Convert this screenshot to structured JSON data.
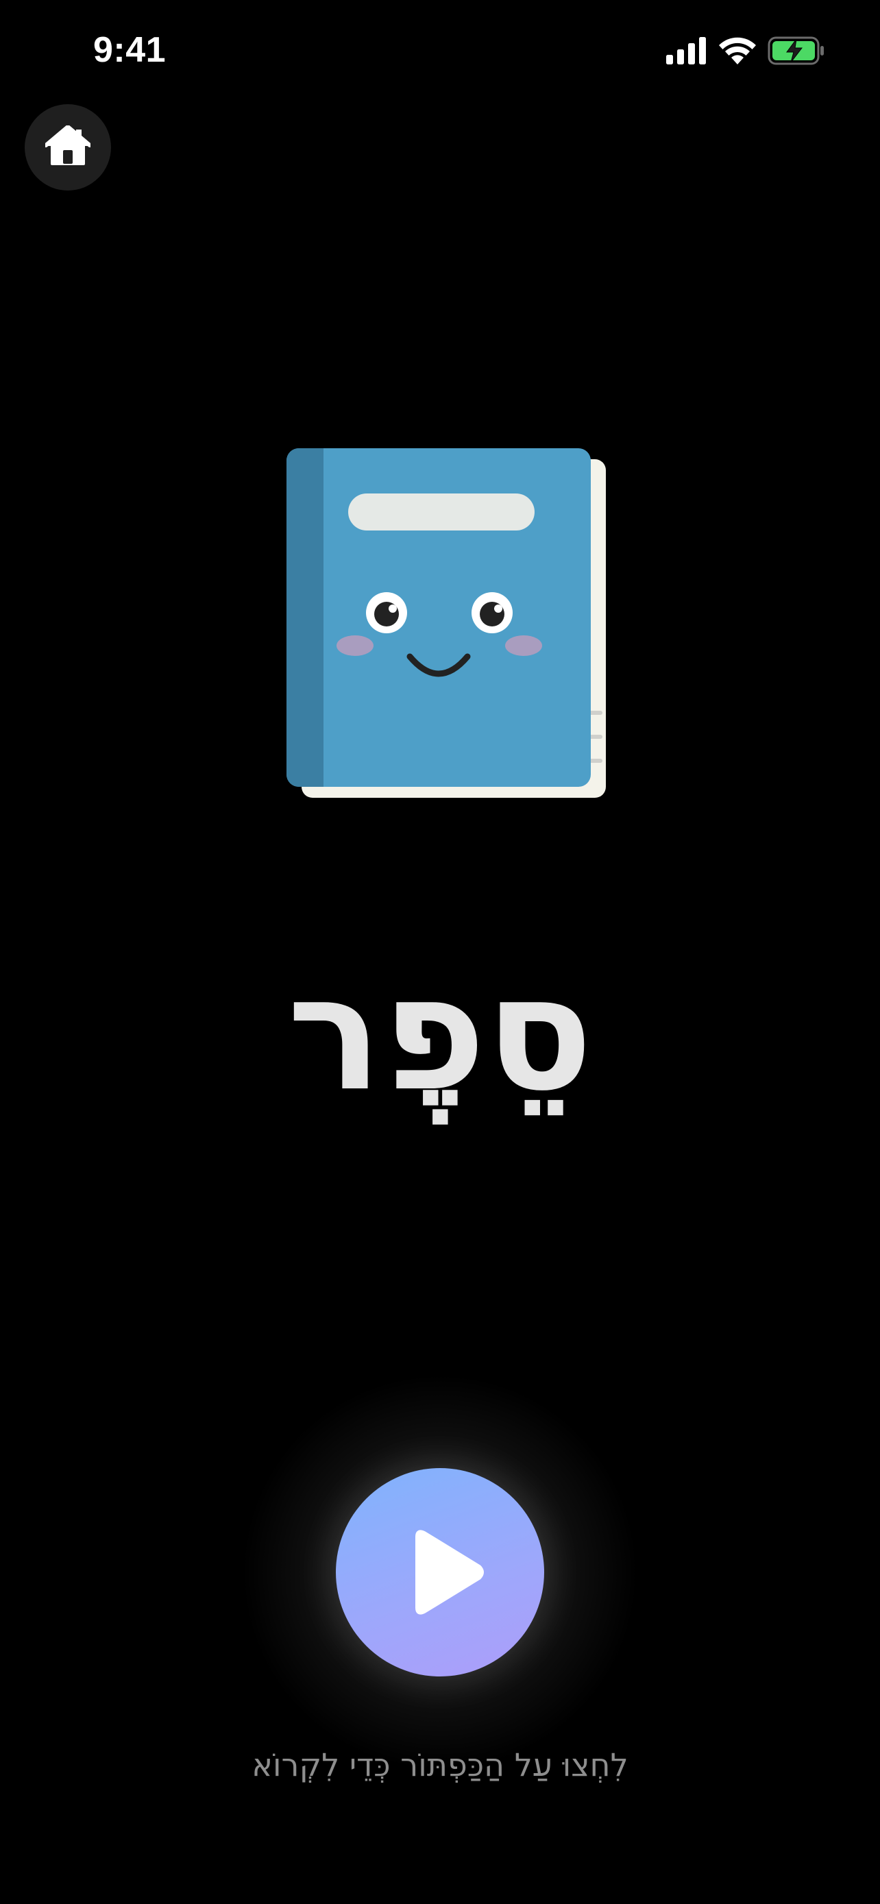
{
  "status_bar": {
    "time": "9:41",
    "icons": [
      "signal-icon",
      "wifi-icon",
      "battery-charging-icon"
    ],
    "battery_color": "#4cd964"
  },
  "home_button": {
    "icon": "home-icon"
  },
  "illustration": {
    "icon": "smiling-book-icon",
    "cover_color": "#4e9fc8",
    "spine_color": "#3b7fa3",
    "pages_color": "#f4f3ea"
  },
  "word": {
    "text": "סֵפֶר"
  },
  "play_button": {
    "icon": "play-icon",
    "gradient_start": "#80b3fd",
    "gradient_end": "#ad9dfa"
  },
  "instruction": {
    "text": "לִחְצוּ עַל הַכַּפְתּוֹר כְּדֵי לִקְרוֹא"
  }
}
